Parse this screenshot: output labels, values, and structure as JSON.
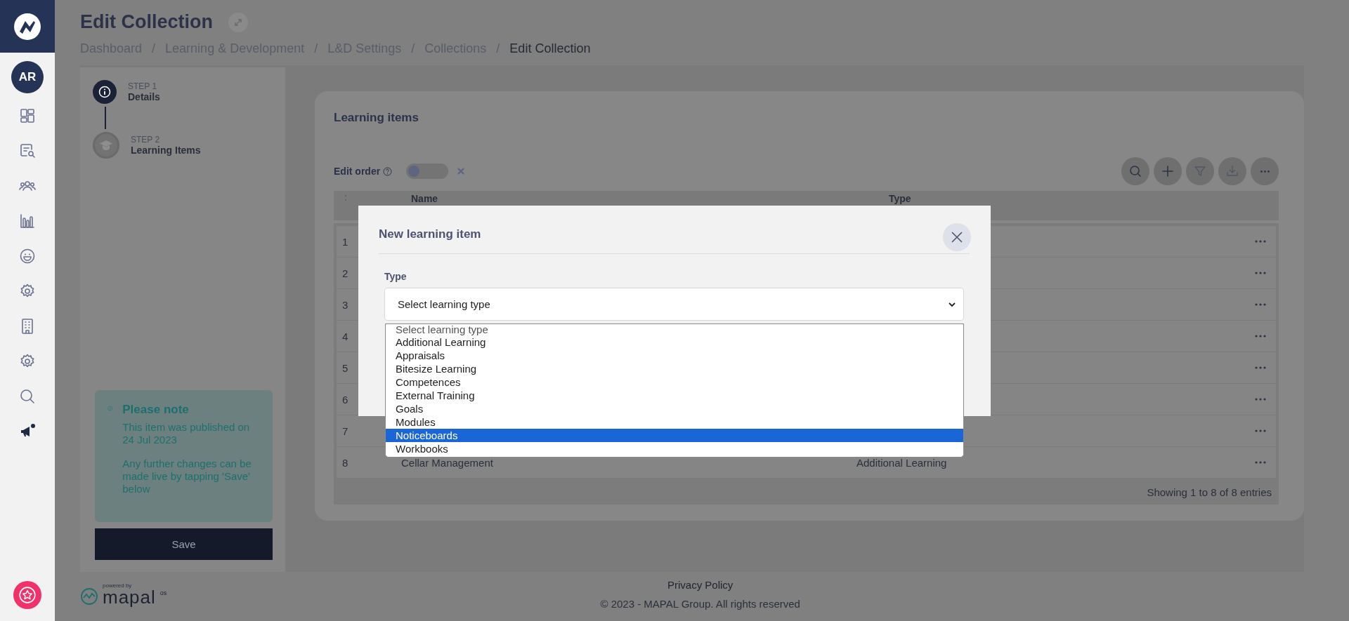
{
  "sidebar": {
    "avatar": "AR"
  },
  "header": {
    "title": "Edit Collection",
    "breadcrumbs": [
      {
        "label": "Dashboard",
        "current": false
      },
      {
        "separator": "/",
        "label": "Learning & Development",
        "current": false
      },
      {
        "separator": "/",
        "label": "L&D Settings",
        "current": false
      },
      {
        "separator": "/",
        "label": "Collections",
        "current": false
      },
      {
        "separator": "/",
        "label": "Edit Collection",
        "current": true
      }
    ]
  },
  "steps": [
    {
      "step": "STEP 1",
      "name": "Details",
      "active": true
    },
    {
      "step": "STEP 2",
      "name": "Learning Items",
      "active": false
    }
  ],
  "note": {
    "title": "Please note",
    "paragraphs": [
      "This item was published on 24 Jul 2023",
      "Any further changes can be made live by tapping 'Save' below"
    ]
  },
  "save_button": "Save",
  "learning_items": {
    "title": "Learning items",
    "edit_order": {
      "label": "Edit order",
      "on": false
    },
    "columns": [
      "Name",
      "Type"
    ],
    "rows": [
      {
        "number": "1"
      },
      {
        "number": "2"
      },
      {
        "number": "3"
      },
      {
        "number": "4"
      },
      {
        "number": "5"
      },
      {
        "number": "6"
      },
      {
        "number": "7"
      },
      {
        "number": "8",
        "name": "Cellar Management",
        "type": "Additional Learning"
      }
    ],
    "summary": "Showing 1 to 8 of 8 entries"
  },
  "footer": {
    "powered_by": "powered by",
    "brand": "mapal",
    "brand_suffix": "os",
    "privacy_link": "Privacy Policy",
    "copyright": "© 2023 - MAPAL Group. All rights reserved"
  },
  "modal": {
    "title": "New learning item",
    "field_label": "Type",
    "select_value": "Select learning type",
    "options": [
      {
        "label": "Select learning type",
        "selected": false
      },
      {
        "label": "Additional Learning",
        "selected": false
      },
      {
        "label": "Appraisals",
        "selected": false
      },
      {
        "label": "Bitesize Learning",
        "selected": false
      },
      {
        "label": "Competences",
        "selected": false
      },
      {
        "label": "External Training",
        "selected": false
      },
      {
        "label": "Goals",
        "selected": false
      },
      {
        "label": "Modules",
        "selected": false
      },
      {
        "label": "Noticeboards",
        "selected": true
      },
      {
        "label": "Workbooks",
        "selected": false
      }
    ]
  }
}
